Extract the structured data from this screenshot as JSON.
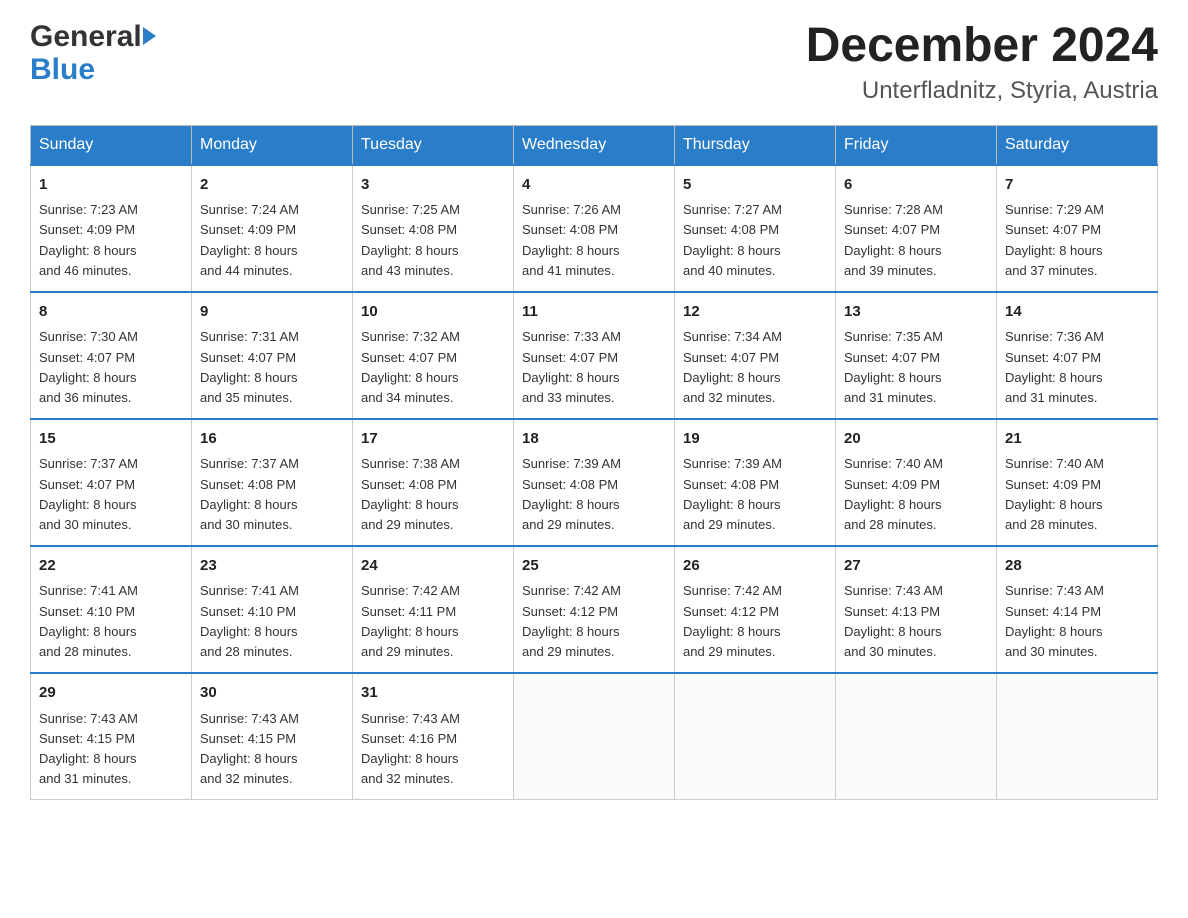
{
  "logo": {
    "line1": "General",
    "line2": "Blue",
    "arrow": true
  },
  "title": "December 2024",
  "subtitle": "Unterfladnitz, Styria, Austria",
  "days_of_week": [
    "Sunday",
    "Monday",
    "Tuesday",
    "Wednesday",
    "Thursday",
    "Friday",
    "Saturday"
  ],
  "weeks": [
    [
      {
        "day": "1",
        "sunrise": "7:23 AM",
        "sunset": "4:09 PM",
        "daylight": "8 hours and 46 minutes."
      },
      {
        "day": "2",
        "sunrise": "7:24 AM",
        "sunset": "4:09 PM",
        "daylight": "8 hours and 44 minutes."
      },
      {
        "day": "3",
        "sunrise": "7:25 AM",
        "sunset": "4:08 PM",
        "daylight": "8 hours and 43 minutes."
      },
      {
        "day": "4",
        "sunrise": "7:26 AM",
        "sunset": "4:08 PM",
        "daylight": "8 hours and 41 minutes."
      },
      {
        "day": "5",
        "sunrise": "7:27 AM",
        "sunset": "4:08 PM",
        "daylight": "8 hours and 40 minutes."
      },
      {
        "day": "6",
        "sunrise": "7:28 AM",
        "sunset": "4:07 PM",
        "daylight": "8 hours and 39 minutes."
      },
      {
        "day": "7",
        "sunrise": "7:29 AM",
        "sunset": "4:07 PM",
        "daylight": "8 hours and 37 minutes."
      }
    ],
    [
      {
        "day": "8",
        "sunrise": "7:30 AM",
        "sunset": "4:07 PM",
        "daylight": "8 hours and 36 minutes."
      },
      {
        "day": "9",
        "sunrise": "7:31 AM",
        "sunset": "4:07 PM",
        "daylight": "8 hours and 35 minutes."
      },
      {
        "day": "10",
        "sunrise": "7:32 AM",
        "sunset": "4:07 PM",
        "daylight": "8 hours and 34 minutes."
      },
      {
        "day": "11",
        "sunrise": "7:33 AM",
        "sunset": "4:07 PM",
        "daylight": "8 hours and 33 minutes."
      },
      {
        "day": "12",
        "sunrise": "7:34 AM",
        "sunset": "4:07 PM",
        "daylight": "8 hours and 32 minutes."
      },
      {
        "day": "13",
        "sunrise": "7:35 AM",
        "sunset": "4:07 PM",
        "daylight": "8 hours and 31 minutes."
      },
      {
        "day": "14",
        "sunrise": "7:36 AM",
        "sunset": "4:07 PM",
        "daylight": "8 hours and 31 minutes."
      }
    ],
    [
      {
        "day": "15",
        "sunrise": "7:37 AM",
        "sunset": "4:07 PM",
        "daylight": "8 hours and 30 minutes."
      },
      {
        "day": "16",
        "sunrise": "7:37 AM",
        "sunset": "4:08 PM",
        "daylight": "8 hours and 30 minutes."
      },
      {
        "day": "17",
        "sunrise": "7:38 AM",
        "sunset": "4:08 PM",
        "daylight": "8 hours and 29 minutes."
      },
      {
        "day": "18",
        "sunrise": "7:39 AM",
        "sunset": "4:08 PM",
        "daylight": "8 hours and 29 minutes."
      },
      {
        "day": "19",
        "sunrise": "7:39 AM",
        "sunset": "4:08 PM",
        "daylight": "8 hours and 29 minutes."
      },
      {
        "day": "20",
        "sunrise": "7:40 AM",
        "sunset": "4:09 PM",
        "daylight": "8 hours and 28 minutes."
      },
      {
        "day": "21",
        "sunrise": "7:40 AM",
        "sunset": "4:09 PM",
        "daylight": "8 hours and 28 minutes."
      }
    ],
    [
      {
        "day": "22",
        "sunrise": "7:41 AM",
        "sunset": "4:10 PM",
        "daylight": "8 hours and 28 minutes."
      },
      {
        "day": "23",
        "sunrise": "7:41 AM",
        "sunset": "4:10 PM",
        "daylight": "8 hours and 28 minutes."
      },
      {
        "day": "24",
        "sunrise": "7:42 AM",
        "sunset": "4:11 PM",
        "daylight": "8 hours and 29 minutes."
      },
      {
        "day": "25",
        "sunrise": "7:42 AM",
        "sunset": "4:12 PM",
        "daylight": "8 hours and 29 minutes."
      },
      {
        "day": "26",
        "sunrise": "7:42 AM",
        "sunset": "4:12 PM",
        "daylight": "8 hours and 29 minutes."
      },
      {
        "day": "27",
        "sunrise": "7:43 AM",
        "sunset": "4:13 PM",
        "daylight": "8 hours and 30 minutes."
      },
      {
        "day": "28",
        "sunrise": "7:43 AM",
        "sunset": "4:14 PM",
        "daylight": "8 hours and 30 minutes."
      }
    ],
    [
      {
        "day": "29",
        "sunrise": "7:43 AM",
        "sunset": "4:15 PM",
        "daylight": "8 hours and 31 minutes."
      },
      {
        "day": "30",
        "sunrise": "7:43 AM",
        "sunset": "4:15 PM",
        "daylight": "8 hours and 32 minutes."
      },
      {
        "day": "31",
        "sunrise": "7:43 AM",
        "sunset": "4:16 PM",
        "daylight": "8 hours and 32 minutes."
      },
      null,
      null,
      null,
      null
    ]
  ],
  "labels": {
    "sunrise": "Sunrise:",
    "sunset": "Sunset:",
    "daylight": "Daylight:"
  }
}
